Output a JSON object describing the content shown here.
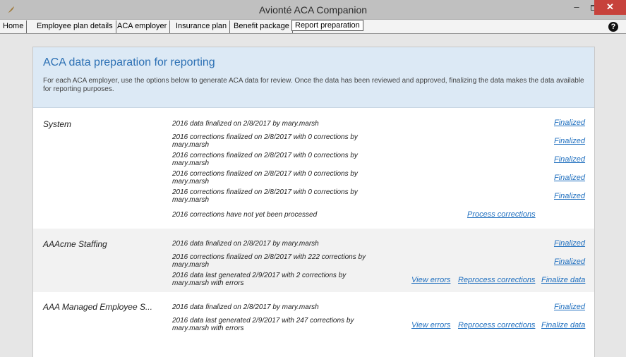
{
  "window": {
    "title": "Avionté ACA Companion",
    "minimize": "–",
    "close": "✕",
    "app_icon": "feather-icon"
  },
  "tabs": [
    {
      "label": "Home"
    },
    {
      "label": "Employee plan details"
    },
    {
      "label": "ACA employer"
    },
    {
      "label": "Insurance plan"
    },
    {
      "label": "Benefit package"
    },
    {
      "label": "Report preparation",
      "active": true
    }
  ],
  "help_icon": "?",
  "panel": {
    "title": "ACA data preparation for reporting",
    "description": "For each ACA employer, use the options below to generate ACA data for review. Once the data has been reviewed and approved, finalizing the data makes the data available for reporting purposes."
  },
  "employers": [
    {
      "name": "System",
      "rows": [
        {
          "text": "2016 data finalized on 2/8/2017 by mary.marsh",
          "action": "Finalized"
        },
        {
          "text": "2016 corrections finalized on 2/8/2017 with 0 corrections by mary.marsh",
          "action": "Finalized"
        },
        {
          "text": "2016 corrections finalized on 2/8/2017 with 0 corrections by mary.marsh",
          "action": "Finalized"
        },
        {
          "text": "2016 corrections finalized on 2/8/2017 with 0 corrections by mary.marsh",
          "action": "Finalized"
        },
        {
          "text": "2016 corrections finalized on 2/8/2017 with 0 corrections by mary.marsh",
          "action": "Finalized"
        },
        {
          "text": "2016 corrections have not yet been processed",
          "action": "Process corrections"
        }
      ]
    },
    {
      "name": "AAAcme Staffing",
      "rows": [
        {
          "text": "2016 data finalized on 2/8/2017 by mary.marsh",
          "action": "Finalized"
        },
        {
          "text": "2016 corrections finalized on 2/8/2017 with 222 corrections by mary.marsh",
          "action": "Finalized"
        },
        {
          "text": "2016 data last generated 2/9/2017 with 2 corrections by mary.marsh  with errors",
          "actions": [
            "View errors",
            "Reprocess corrections",
            "Finalize data"
          ]
        }
      ]
    },
    {
      "name": "AAA Managed Employee S...",
      "rows": [
        {
          "text": "2016 data finalized on 2/8/2017 by mary.marsh",
          "action": "Finalized"
        },
        {
          "text": "2016 data last generated 2/9/2017 with 247 corrections by mary.marsh  with errors",
          "actions": [
            "View errors",
            "Reprocess corrections",
            "Finalize data"
          ]
        }
      ]
    }
  ]
}
